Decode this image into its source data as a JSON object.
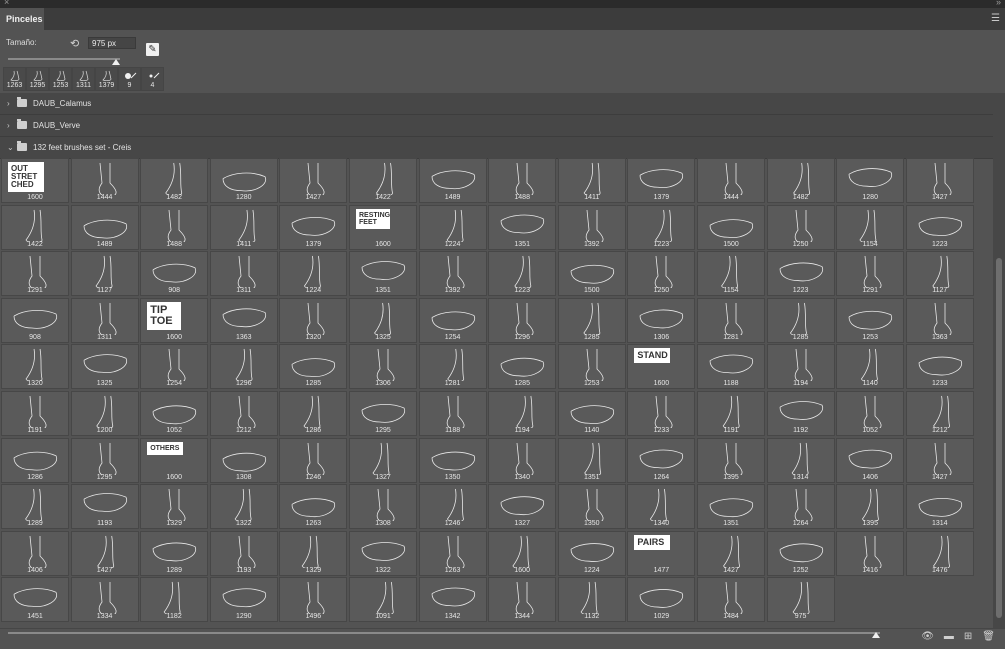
{
  "window": {
    "close_glyph": "×",
    "collapse_glyph": "»"
  },
  "panel": {
    "tab_label": "Pinceles",
    "menu_icon": "hamburger-menu-icon"
  },
  "settings": {
    "size_label": "Tamaño:",
    "size_value": "975 px",
    "size_fraction": 0.96
  },
  "recent_brushes": [
    "1263",
    "1295",
    "1253",
    "1311",
    "1379",
    "9",
    "4"
  ],
  "groups": [
    {
      "name": "DAUB_Calamus",
      "expanded": false
    },
    {
      "name": "DAUB_Verve",
      "expanded": false
    },
    {
      "name": "132 feet brushes set - Creis",
      "expanded": true
    }
  ],
  "brushes": [
    "1600",
    "1444",
    "1482",
    "1280",
    "1427",
    "1422",
    "1489",
    "1488",
    "1411",
    "1379",
    "1444",
    "1482",
    "1280",
    "1427",
    "1422",
    "1489",
    "1488",
    "1411",
    "1379",
    "1600",
    "1224",
    "1351",
    "1392",
    "1223",
    "1500",
    "1250",
    "1154",
    "1223",
    "1291",
    "1127",
    "908",
    "1311",
    "1224",
    "1351",
    "1392",
    "1223",
    "1500",
    "1250",
    "1154",
    "1223",
    "1291",
    "1127",
    "908",
    "1311",
    "1600",
    "1363",
    "1320",
    "1325",
    "1254",
    "1296",
    "1285",
    "1306",
    "1281",
    "1285",
    "1253",
    "1363",
    "1320",
    "1325",
    "1254",
    "1296",
    "1285",
    "1306",
    "1281",
    "1285",
    "1253",
    "1600",
    "1188",
    "1194",
    "1140",
    "1233",
    "1191",
    "1200",
    "1052",
    "1212",
    "1286",
    "1295",
    "1188",
    "1194",
    "1140",
    "1233",
    "1191",
    "1192",
    "1052",
    "1212",
    "1286",
    "1295",
    "1600",
    "1308",
    "1246",
    "1327",
    "1350",
    "1340",
    "1351",
    "1264",
    "1395",
    "1314",
    "1406",
    "1427",
    "1289",
    "1193",
    "1329",
    "1322",
    "1263",
    "1308",
    "1246",
    "1327",
    "1350",
    "1340",
    "1351",
    "1264",
    "1395",
    "1314",
    "1406",
    "1427",
    "1289",
    "1193",
    "1329",
    "1322",
    "1263",
    "1600",
    "1224",
    "1477",
    "1427",
    "1252",
    "1416",
    "1476",
    "1451",
    "1334",
    "1182",
    "1290",
    "1496",
    "1091",
    "1342",
    "1344",
    "1132",
    "1029",
    "1484",
    "975"
  ],
  "labeled_tiles": {
    "0": {
      "text": "OUT\nSTRET\nCHED"
    },
    "19": {
      "text": "RESTING\nFEET"
    },
    "44": {
      "text": "TIP\nTOE"
    },
    "65": {
      "text": "STAND"
    },
    "86": {
      "text": "OTHERS"
    },
    "121": {
      "text": "PAIRS"
    }
  },
  "bottom": {
    "preview_fraction": 0.995
  }
}
